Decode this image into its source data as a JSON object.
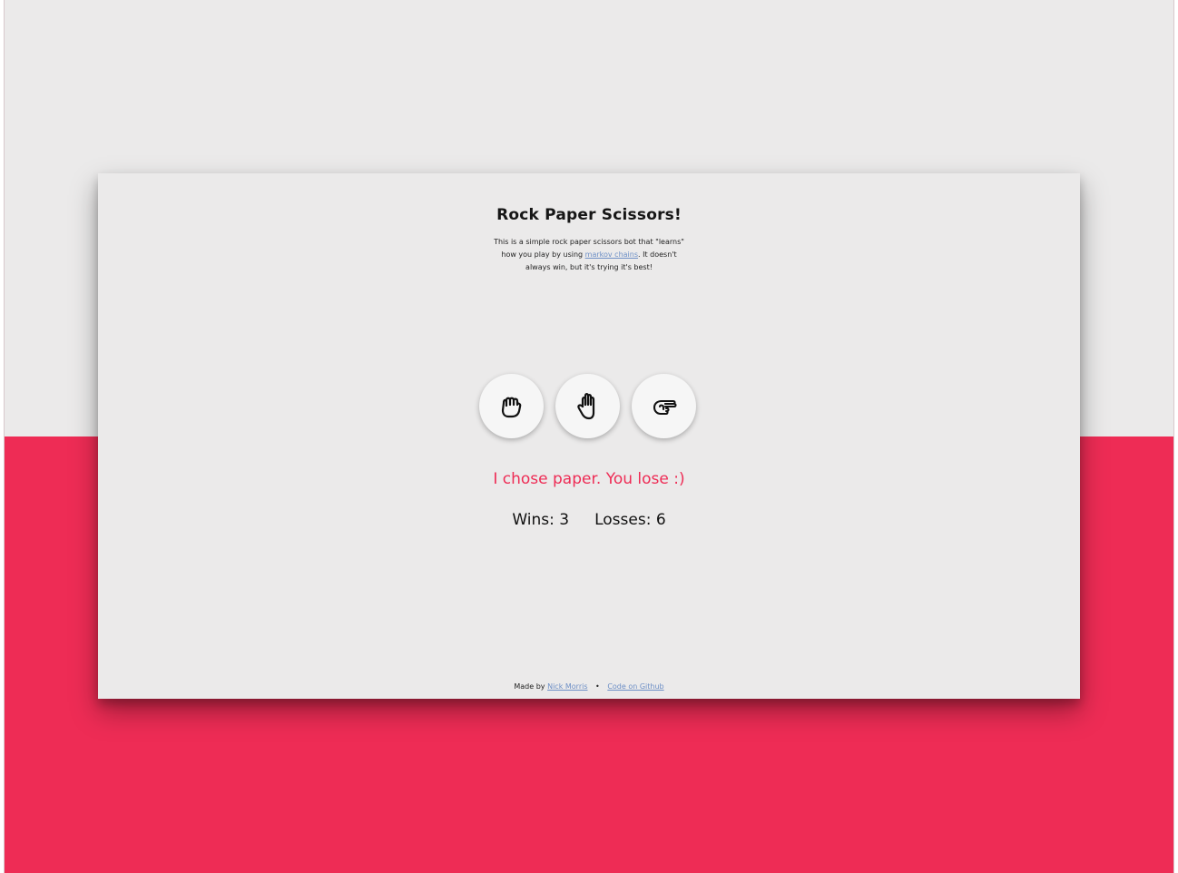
{
  "app": {
    "title": "Rock Paper Scissors!",
    "description_parts": {
      "before_link": "This is a simple rock paper scissors bot that \"learns\" how you play by using",
      "link": "markov chains",
      "after_link": ". It doesn't always win, but it's trying it's best!"
    }
  },
  "choices": [
    {
      "name": "rock",
      "icon": "rock-icon"
    },
    {
      "name": "paper",
      "icon": "paper-icon"
    },
    {
      "name": "scissors",
      "icon": "scissors-icon"
    }
  ],
  "result": {
    "text": "I chose paper. You lose :)",
    "color": "#ee2c55"
  },
  "score": {
    "wins_label": "Wins: 3",
    "losses_label": "Losses: 6"
  },
  "footer": {
    "made_by_prefix": "Made by",
    "author_link": "Nick Morris",
    "separator": "•",
    "github_link": "Code on Github"
  },
  "colors": {
    "accent": "#ee2c55",
    "background": "#ebeaea",
    "link": "#6d8fc6"
  }
}
